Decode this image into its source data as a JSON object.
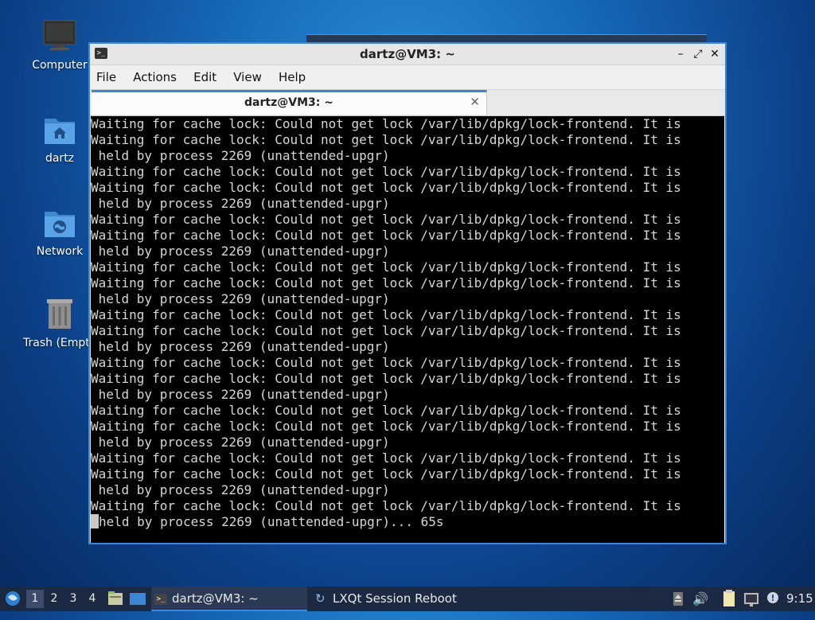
{
  "desktop": {
    "icons": [
      {
        "label": "Computer",
        "icon": "monitor-icon"
      },
      {
        "label": "dartz",
        "icon": "home-folder-icon"
      },
      {
        "label": "Network",
        "icon": "network-folder-icon"
      },
      {
        "label": "Trash (Empt",
        "icon": "trash-icon"
      }
    ]
  },
  "window": {
    "title": "dartz@VM3: ~",
    "controls": {
      "minimize": "–",
      "restore": "⤢",
      "close": "✕"
    },
    "menu": [
      "File",
      "Actions",
      "Edit",
      "View",
      "Help"
    ],
    "tab": {
      "label": "dartz@VM3: ~",
      "close": "✕"
    }
  },
  "terminal": {
    "lines": [
      "Waiting for cache lock: Could not get lock /var/lib/dpkg/lock-frontend. It is",
      "Waiting for cache lock: Could not get lock /var/lib/dpkg/lock-frontend. It is",
      " held by process 2269 (unattended-upgr)",
      "Waiting for cache lock: Could not get lock /var/lib/dpkg/lock-frontend. It is",
      "Waiting for cache lock: Could not get lock /var/lib/dpkg/lock-frontend. It is",
      " held by process 2269 (unattended-upgr)",
      "Waiting for cache lock: Could not get lock /var/lib/dpkg/lock-frontend. It is",
      "Waiting for cache lock: Could not get lock /var/lib/dpkg/lock-frontend. It is",
      " held by process 2269 (unattended-upgr)",
      "Waiting for cache lock: Could not get lock /var/lib/dpkg/lock-frontend. It is",
      "Waiting for cache lock: Could not get lock /var/lib/dpkg/lock-frontend. It is",
      " held by process 2269 (unattended-upgr)",
      "Waiting for cache lock: Could not get lock /var/lib/dpkg/lock-frontend. It is",
      "Waiting for cache lock: Could not get lock /var/lib/dpkg/lock-frontend. It is",
      " held by process 2269 (unattended-upgr)",
      "Waiting for cache lock: Could not get lock /var/lib/dpkg/lock-frontend. It is",
      "Waiting for cache lock: Could not get lock /var/lib/dpkg/lock-frontend. It is",
      " held by process 2269 (unattended-upgr)",
      "Waiting for cache lock: Could not get lock /var/lib/dpkg/lock-frontend. It is",
      "Waiting for cache lock: Could not get lock /var/lib/dpkg/lock-frontend. It is",
      " held by process 2269 (unattended-upgr)",
      "Waiting for cache lock: Could not get lock /var/lib/dpkg/lock-frontend. It is",
      "Waiting for cache lock: Could not get lock /var/lib/dpkg/lock-frontend. It is",
      " held by process 2269 (unattended-upgr)",
      "Waiting for cache lock: Could not get lock /var/lib/dpkg/lock-frontend. It is"
    ],
    "last_line": "held by process 2269 (unattended-upgr)... 65s"
  },
  "taskbar": {
    "workspaces": [
      "1",
      "2",
      "3",
      "4"
    ],
    "active_workspace": "1",
    "tasks": [
      {
        "label": "dartz@VM3: ~",
        "icon": "terminal-icon"
      },
      {
        "label": "LXQt Session Reboot",
        "icon": "reboot-icon"
      }
    ],
    "clock": "9:15"
  },
  "colors": {
    "accent": "#3d86d6",
    "terminal_bg": "#000000",
    "terminal_fg": "#d6d6d6",
    "taskbar_bg": "#1b2a42"
  }
}
